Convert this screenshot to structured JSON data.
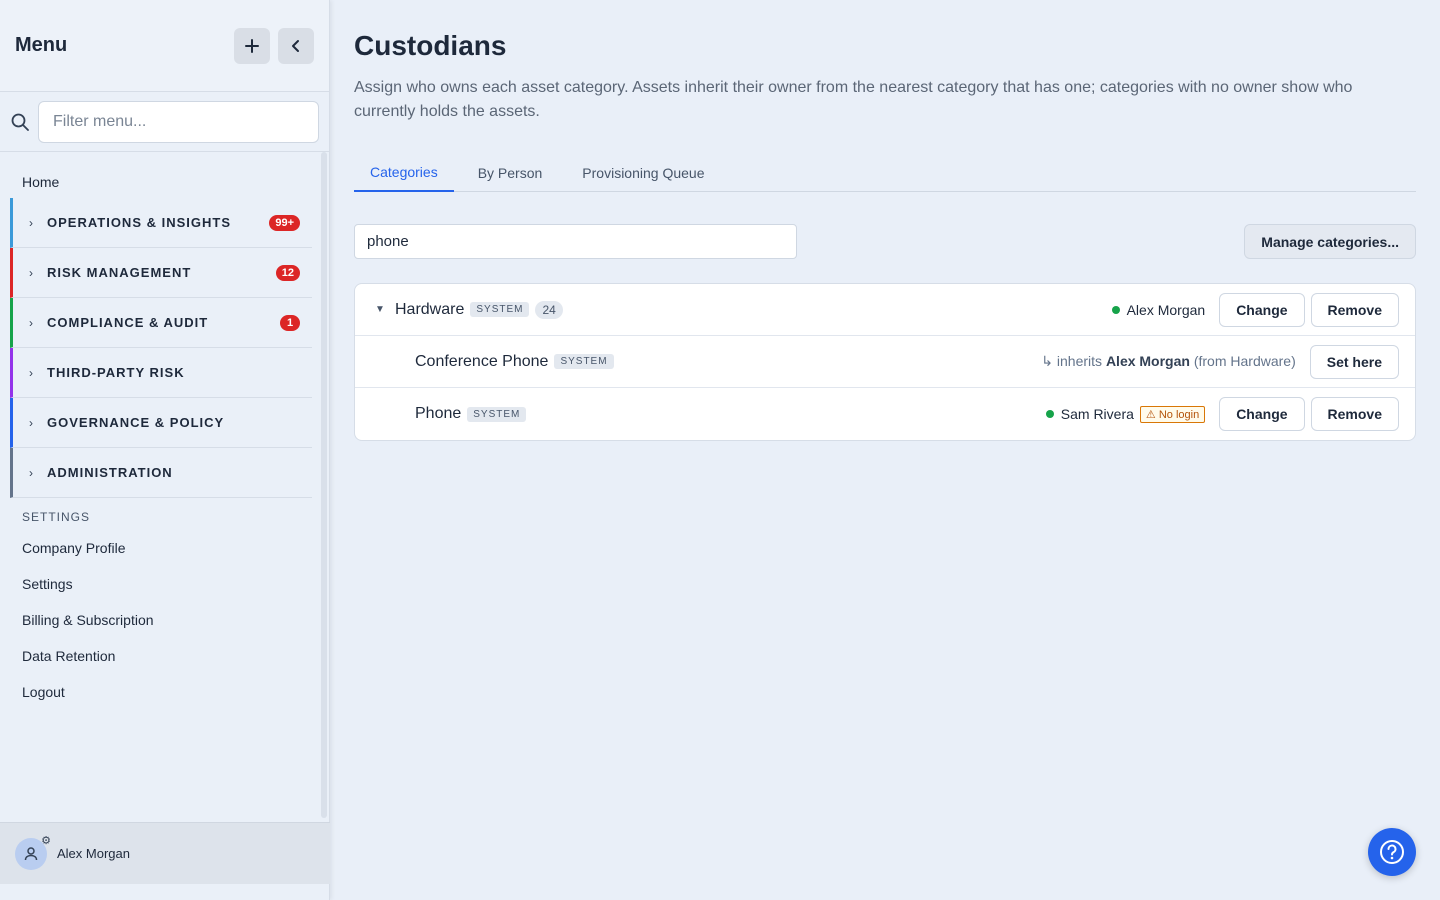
{
  "sidebar": {
    "title": "Menu",
    "add_icon": "plus-icon",
    "collapse_icon": "chevron-left-icon",
    "filter_placeholder": "Filter menu...",
    "home": "Home",
    "groups": [
      {
        "label": "OPERATIONS & INSIGHTS",
        "badge": "99+",
        "color": "#3b9ad9"
      },
      {
        "label": "RISK MANAGEMENT",
        "badge": "12",
        "color": "#dc2626"
      },
      {
        "label": "COMPLIANCE & AUDIT",
        "badge": "1",
        "color": "#16a34a"
      },
      {
        "label": "THIRD-PARTY RISK",
        "badge": "",
        "color": "#9333ea"
      },
      {
        "label": "GOVERNANCE & POLICY",
        "badge": "",
        "color": "#2563eb"
      },
      {
        "label": "ADMINISTRATION",
        "badge": "",
        "color": "#64748b"
      }
    ],
    "settings_heading": "SETTINGS",
    "settings_items": [
      "Company Profile",
      "Settings",
      "Billing & Subscription",
      "Data Retention",
      "Logout"
    ],
    "user_name": "Alex Morgan"
  },
  "main": {
    "title": "Custodians",
    "description": "Assign who owns each asset category. Assets inherit their owner from the nearest category that has one; categories with no owner show who currently holds the assets.",
    "tabs": [
      "Categories",
      "By Person",
      "Provisioning Queue"
    ],
    "active_tab": "Categories",
    "search_value": "phone",
    "manage_label": "Manage categories...",
    "rows": [
      {
        "name": "Hardware",
        "tag": "SYSTEM",
        "count": "24",
        "owner": "Alex Morgan",
        "change": "Change",
        "remove": "Remove"
      },
      {
        "name": "Conference Phone",
        "tag": "SYSTEM",
        "inherits_prefix": "↳ inherits",
        "inherits_owner": "Alex Morgan",
        "inherits_suffix": "(from Hardware)",
        "set_here": "Set here"
      },
      {
        "name": "Phone",
        "tag": "SYSTEM",
        "owner": "Sam Rivera",
        "warning": "⚠ No login",
        "change": "Change",
        "remove": "Remove"
      }
    ]
  },
  "help_icon": "question-circle-icon",
  "colors": {
    "accent": "#2563eb",
    "badge": "#dc2626",
    "status_ok": "#16a34a",
    "warning": "#d97706"
  }
}
